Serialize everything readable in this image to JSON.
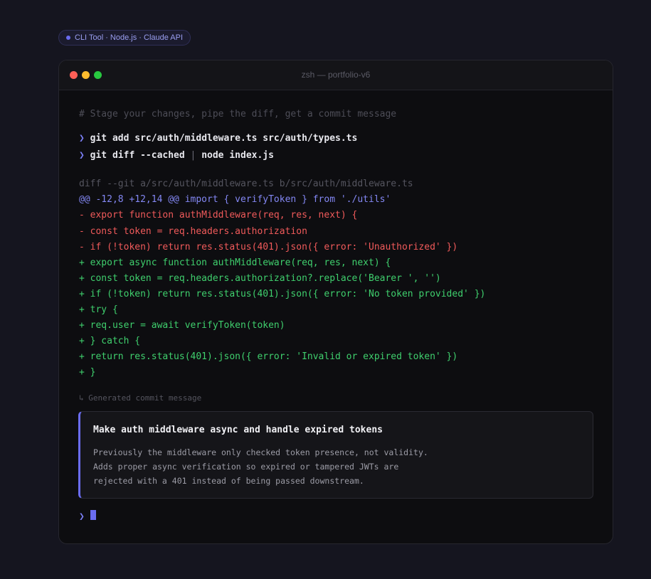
{
  "badge": {
    "label": "CLI Tool · Node.js · Claude API"
  },
  "window": {
    "title": "zsh — portfolio-v6"
  },
  "terminal": {
    "comment": "# Stage your changes, pipe the diff, get a commit message",
    "prompt_symbol": "❯",
    "commands": [
      {
        "text": "git add src/auth/middleware.ts src/auth/types.ts"
      },
      {
        "before_pipe": "git diff --cached ",
        "pipe": "|",
        "after_pipe": " node index.js"
      }
    ],
    "diff": {
      "header": "diff --git a/src/auth/middleware.ts b/src/auth/middleware.ts",
      "hunk": "@@ -12,8 +12,14 @@ import { verifyToken } from './utils'",
      "lines": [
        {
          "type": "removed",
          "text": "- export function authMiddleware(req, res, next) {"
        },
        {
          "type": "removed",
          "text": "- const token = req.headers.authorization"
        },
        {
          "type": "removed",
          "text": "- if (!token) return res.status(401).json({ error: 'Unauthorized' })"
        },
        {
          "type": "added",
          "text": "+ export async function authMiddleware(req, res, next) {"
        },
        {
          "type": "added",
          "text": "+ const token = req.headers.authorization?.replace('Bearer ', '')"
        },
        {
          "type": "added",
          "text": "+ if (!token) return res.status(401).json({ error: 'No token provided' })"
        },
        {
          "type": "added",
          "text": "+ try {"
        },
        {
          "type": "added",
          "text": "+ req.user = await verifyToken(token)"
        },
        {
          "type": "added",
          "text": "+ } catch {"
        },
        {
          "type": "added",
          "text": "+ return res.status(401).json({ error: 'Invalid or expired token' })"
        },
        {
          "type": "added",
          "text": "+ }"
        }
      ]
    },
    "generated_label": "↳ Generated commit message",
    "commit": {
      "title": "Make auth middleware async and handle expired tokens",
      "body": [
        "Previously the middleware only checked token presence, not validity.",
        "Adds proper async verification so expired or tampered JWTs are",
        "rejected with a 401 instead of being passed downstream."
      ]
    }
  }
}
